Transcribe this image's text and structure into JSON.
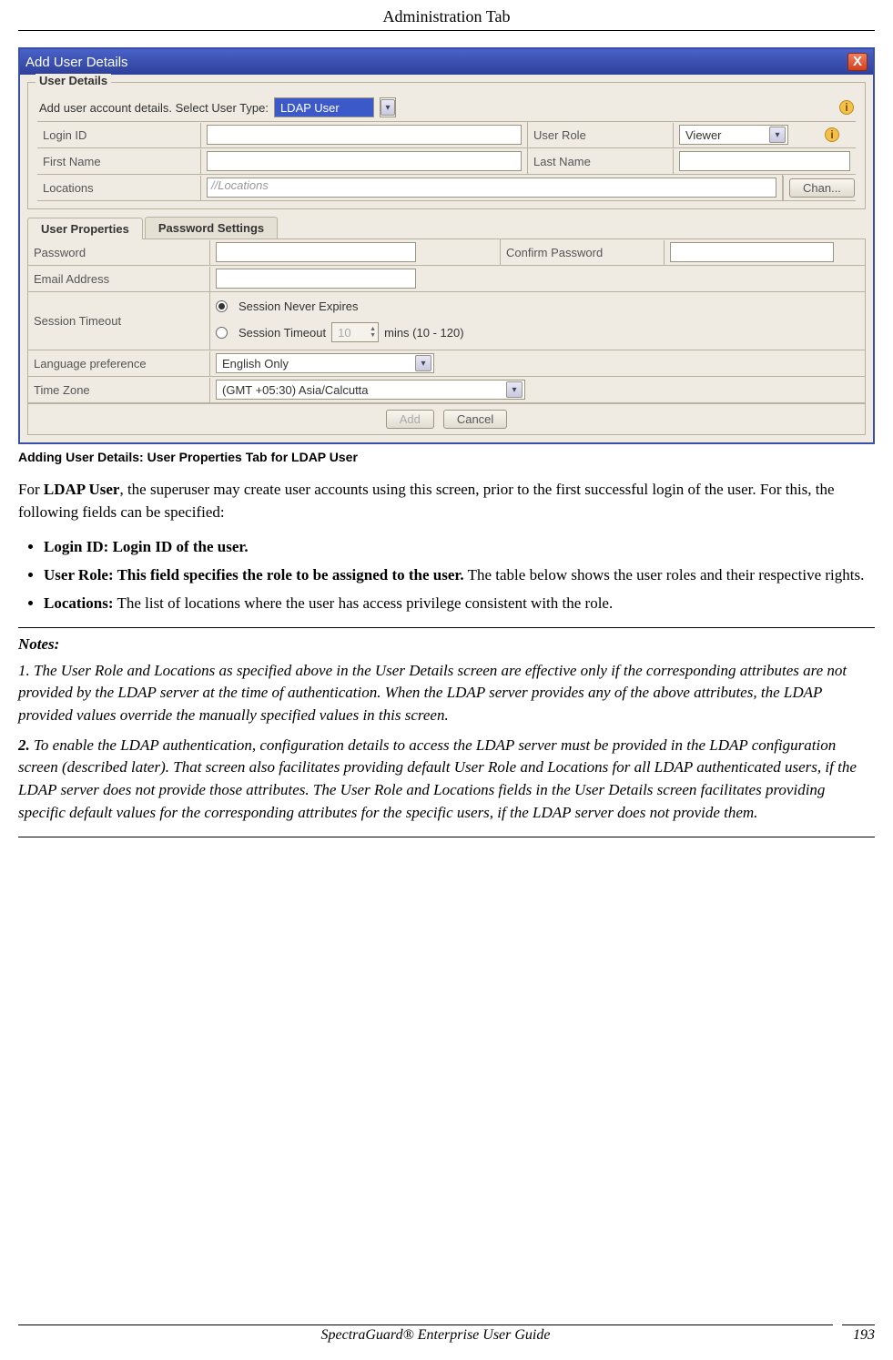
{
  "header": "Administration Tab",
  "dialog": {
    "title": "Add User Details",
    "panel_title": "User Details",
    "instruction": "Add user account details.  Select User Type:",
    "user_type": "LDAP User",
    "fields": {
      "login_id": "Login ID",
      "user_role": "User Role",
      "role_value": "Viewer",
      "first_name": "First Name",
      "last_name": "Last Name",
      "locations": "Locations",
      "locations_placeholder": "//Locations",
      "change_btn": "Chan..."
    },
    "tabs": {
      "props": "User Properties",
      "pwd": "Password Settings"
    },
    "props": {
      "password": "Password",
      "confirm": "Confirm Password",
      "email": "Email Address",
      "session": "Session Timeout",
      "session_never": "Session Never Expires",
      "session_timeout": "Session Timeout",
      "session_val": "10",
      "session_suffix": "mins (10 - 120)",
      "lang": "Language preference",
      "lang_val": "English Only",
      "tz": "Time Zone",
      "tz_val": "(GMT +05:30)   Asia/Calcutta"
    },
    "buttons": {
      "add": "Add",
      "cancel": "Cancel"
    }
  },
  "caption": "Adding User Details: User Properties Tab for LDAP User",
  "body": {
    "p1a": "For ",
    "p1b": "LDAP User",
    "p1c": ", the superuser may create user accounts using this screen, prior to the first successful login of the user. For this, the following fields can be specified:",
    "li1": "Login ID: Login ID of the user.",
    "li2a": "User Role: This field specifies the role to be assigned to the user.",
    "li2b": " The table below shows the user roles and their respective rights.",
    "li3a": "Locations:",
    "li3b": " The list of locations where the user has access privilege consistent with the role."
  },
  "notes": {
    "title": "Notes",
    "n1": "1. The User Role and Locations as specified above in the User Details screen are effective only if the corresponding attributes are not provided by the LDAP server at the time of authentication. When the LDAP server provides any of the above attributes, the LDAP provided values override the manually specified values in this screen.",
    "n2a": "2.",
    "n2b": " To enable the LDAP authentication, configuration details to access the LDAP server must be provided in the LDAP configuration screen (described later). That screen also facilitates providing default User Role and Locations for all LDAP authenticated users, if the LDAP server does not provide those attributes. The User Role and Locations fields  in the User Details screen facilitates providing specific default values for the corresponding attributes for the specific users, if the LDAP server does not provide them."
  },
  "footer": {
    "guide": "SpectraGuard®  Enterprise User Guide",
    "page": "193"
  }
}
